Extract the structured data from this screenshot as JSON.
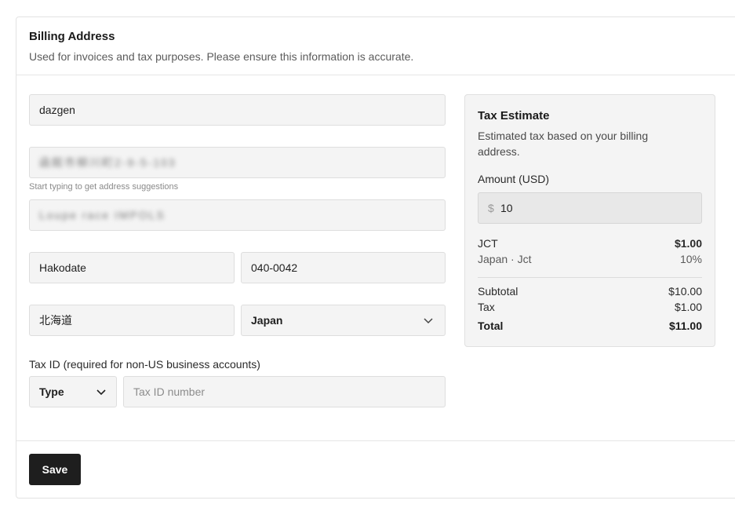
{
  "billing": {
    "title": "Billing Address",
    "subtitle": "Used for invoices and tax purposes. Please ensure this information is accurate.",
    "name_value": "dazgen",
    "address1_value": "函館市柳川町2-9-5-103",
    "address_hint": "Start typing to get address suggestions",
    "address2_value": "Loupe race IMPOLS",
    "city_value": "Hakodate",
    "postal_value": "040-0042",
    "state_value": "北海道",
    "country_selected": "Japan",
    "tax_id_label": "Tax ID (required for non-US business accounts)",
    "tax_type_selected": "Type",
    "tax_id_placeholder": "Tax ID number",
    "save_label": "Save"
  },
  "tax_estimate": {
    "title": "Tax Estimate",
    "description": "Estimated tax based on your billing address.",
    "amount_label": "Amount (USD)",
    "currency_symbol": "$",
    "amount_value": "10",
    "lines": [
      {
        "label": "JCT",
        "value": "$1.00"
      },
      {
        "label": "Japan · Jct",
        "value": "10%"
      }
    ],
    "subtotal_label": "Subtotal",
    "subtotal_value": "$10.00",
    "tax_label": "Tax",
    "tax_value": "$1.00",
    "total_label": "Total",
    "total_value": "$11.00"
  },
  "icons": {
    "country_chevron": "chevron-down-icon",
    "tax_type_chevron": "chevron-down-icon"
  },
  "colors": {
    "button_bg": "#1e1e1e",
    "input_bg": "#f4f4f4",
    "panel_bg": "#f4f4f4"
  }
}
